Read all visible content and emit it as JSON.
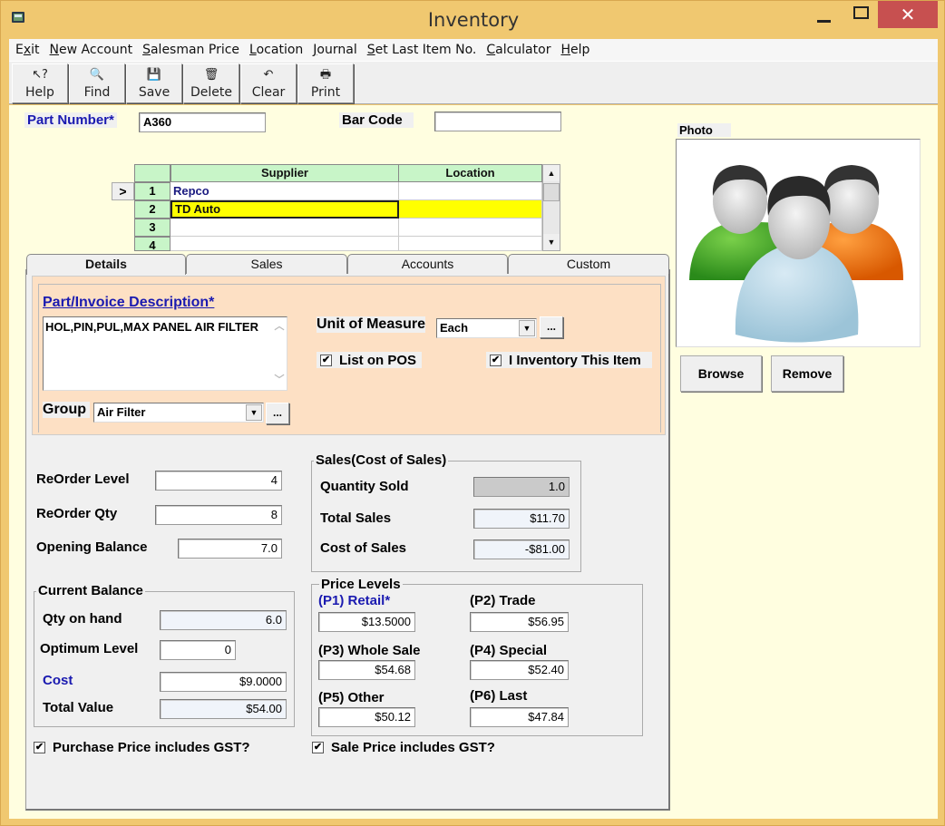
{
  "window": {
    "title": "Inventory",
    "controls": {
      "minimize": "minimize",
      "maximize": "maximize",
      "close": "✕"
    }
  },
  "menu": [
    {
      "label": "Exit",
      "mnemonic_index": 1
    },
    {
      "label": "New Account",
      "mnemonic_index": 0
    },
    {
      "label": "Salesman Price",
      "mnemonic_index": 0
    },
    {
      "label": "Location",
      "mnemonic_index": 0
    },
    {
      "label": "Journal",
      "mnemonic_index": 0
    },
    {
      "label": "Set Last Item No.",
      "mnemonic_index": 0
    },
    {
      "label": "Calculator",
      "mnemonic_index": 0
    },
    {
      "label": "Help",
      "mnemonic_index": 0
    }
  ],
  "toolbar": [
    {
      "label": "Help",
      "icon": "help-pointer-icon",
      "glyph": "↖?"
    },
    {
      "label": "Find",
      "icon": "find-icon",
      "glyph": "🔍"
    },
    {
      "label": "Save",
      "icon": "save-disk-icon",
      "glyph": "💾"
    },
    {
      "label": "Delete",
      "icon": "recycle-bin-icon",
      "glyph": "🗑"
    },
    {
      "label": "Clear",
      "icon": "undo-icon",
      "glyph": "↶"
    },
    {
      "label": "Print",
      "icon": "printer-icon",
      "glyph": "🖶"
    }
  ],
  "header": {
    "part_number_label": "Part Number*",
    "part_number_value": "A360",
    "bar_code_label": "Bar Code",
    "bar_code_value": ""
  },
  "supplier_grid": {
    "columns": [
      "Supplier",
      "Location"
    ],
    "current_row_marker": ">",
    "rows": [
      {
        "num": "1",
        "supplier": "Repco",
        "location": ""
      },
      {
        "num": "2",
        "supplier": "TD Auto",
        "location": ""
      },
      {
        "num": "3",
        "supplier": "",
        "location": ""
      },
      {
        "num": "4",
        "supplier": "",
        "location": ""
      }
    ],
    "selected_row": 2
  },
  "tabs": [
    {
      "label": "Details",
      "active": true
    },
    {
      "label": "Sales",
      "active": false
    },
    {
      "label": "Accounts",
      "active": false
    },
    {
      "label": "Custom",
      "active": false
    }
  ],
  "details": {
    "description_label": "Part/Invoice Description*",
    "description_value": "HOL,PIN,PUL,MAX PANEL AIR FILTER",
    "unit_label": "Unit of Measure",
    "unit_value": "Each",
    "list_on_pos_label": "List on POS",
    "list_on_pos_checked": true,
    "inventory_item_label": "I Inventory This Item",
    "inventory_item_checked": true,
    "group_label": "Group",
    "group_value": "Air Filter",
    "ellipsis": "..."
  },
  "reorder": {
    "reorder_level_label": "ReOrder Level",
    "reorder_level_value": "4",
    "reorder_qty_label": "ReOrder Qty",
    "reorder_qty_value": "8",
    "opening_balance_label": "Opening Balance",
    "opening_balance_value": "7.0"
  },
  "sales": {
    "title": "Sales(Cost of Sales)",
    "qty_sold_label": "Quantity Sold",
    "qty_sold_value": "1.0",
    "total_sales_label": "Total Sales",
    "total_sales_value": "$11.70",
    "cost_of_sales_label": "Cost of Sales",
    "cost_of_sales_value": "-$81.00"
  },
  "balance": {
    "title": "Current Balance",
    "qty_on_hand_label": "Qty on hand",
    "qty_on_hand_value": "6.0",
    "optimum_label": "Optimum Level",
    "optimum_value": "0",
    "cost_label": "Cost",
    "cost_value": "$9.0000",
    "total_value_label": "Total Value",
    "total_value_value": "$54.00"
  },
  "price_levels": {
    "title": "Price Levels",
    "levels": [
      {
        "label": "(P1) Retail*",
        "value": "$13.5000"
      },
      {
        "label": "(P2) Trade",
        "value": "$56.95"
      },
      {
        "label": "(P3) Whole Sale",
        "value": "$54.68"
      },
      {
        "label": "(P4) Special",
        "value": "$52.40"
      },
      {
        "label": "(P5) Other",
        "value": "$50.12"
      },
      {
        "label": "(P6) Last",
        "value": "$47.84"
      }
    ]
  },
  "gst": {
    "purchase_label": "Purchase Price includes GST?",
    "purchase_checked": true,
    "sale_label": "Sale Price includes GST?",
    "sale_checked": true
  },
  "photo": {
    "label": "Photo",
    "image": "users-group-icon",
    "browse_label": "Browse",
    "remove_label": "Remove"
  },
  "colors": {
    "title_bar": "#f0c870",
    "close_button": "#c75050",
    "client_bg": "#fffee0",
    "details_bg": "#fde0c4",
    "grid_header": "#c8f5c8",
    "selected_row": "#ffff00",
    "required_label": "#1a1ab0"
  },
  "check_glyph": "✔"
}
